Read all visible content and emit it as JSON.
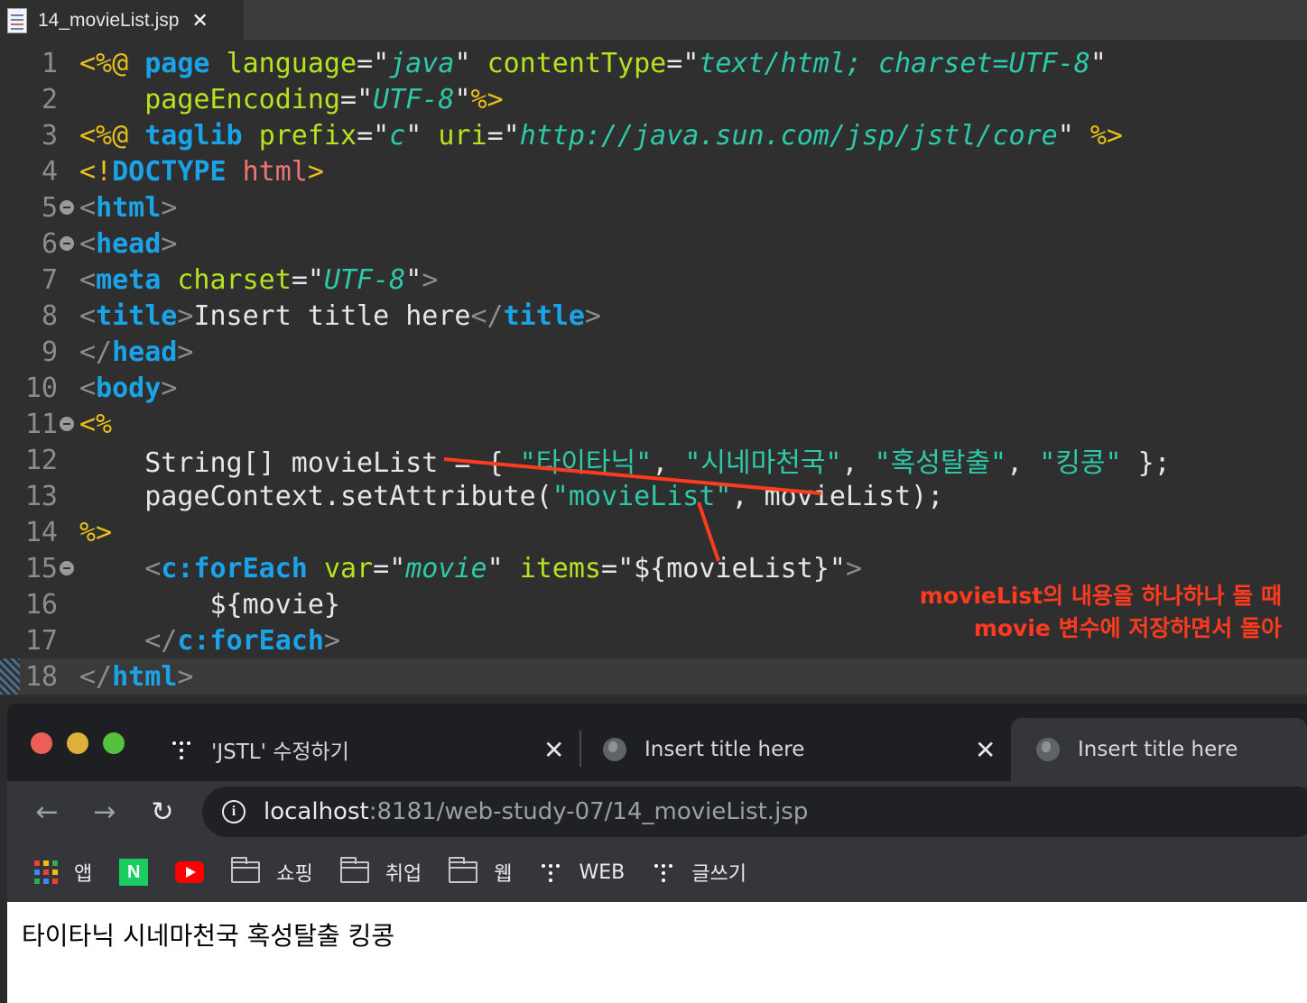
{
  "editor": {
    "tab_title": "14_movieList.jsp",
    "close_glyph": "✕",
    "lines": [
      {
        "num": "1",
        "fold": false,
        "current": false,
        "tokens": [
          {
            "t": "<%@ ",
            "c": "c-dir"
          },
          {
            "t": "page",
            "c": "c-kw"
          },
          {
            "t": " ",
            "c": "c-plain"
          },
          {
            "t": "language",
            "c": "c-attr"
          },
          {
            "t": "=",
            "c": "c-plain"
          },
          {
            "t": "\"",
            "c": "c-plain"
          },
          {
            "t": "java",
            "c": "c-str"
          },
          {
            "t": "\"",
            "c": "c-plain"
          },
          {
            "t": " ",
            "c": "c-plain"
          },
          {
            "t": "contentType",
            "c": "c-attr"
          },
          {
            "t": "=",
            "c": "c-plain"
          },
          {
            "t": "\"",
            "c": "c-plain"
          },
          {
            "t": "text/html; charset=UTF-8",
            "c": "c-str"
          },
          {
            "t": "\"",
            "c": "c-plain"
          }
        ]
      },
      {
        "num": "2",
        "fold": false,
        "current": false,
        "tokens": [
          {
            "t": "    ",
            "c": "c-plain"
          },
          {
            "t": "pageEncoding",
            "c": "c-attr"
          },
          {
            "t": "=",
            "c": "c-plain"
          },
          {
            "t": "\"",
            "c": "c-plain"
          },
          {
            "t": "UTF-8",
            "c": "c-str"
          },
          {
            "t": "\"",
            "c": "c-plain"
          },
          {
            "t": "%>",
            "c": "c-dir"
          }
        ]
      },
      {
        "num": "3",
        "fold": false,
        "current": false,
        "tokens": [
          {
            "t": "<%@ ",
            "c": "c-dir"
          },
          {
            "t": "taglib",
            "c": "c-kw"
          },
          {
            "t": " ",
            "c": "c-plain"
          },
          {
            "t": "prefix",
            "c": "c-attr"
          },
          {
            "t": "=",
            "c": "c-plain"
          },
          {
            "t": "\"",
            "c": "c-plain"
          },
          {
            "t": "c",
            "c": "c-str"
          },
          {
            "t": "\"",
            "c": "c-plain"
          },
          {
            "t": " ",
            "c": "c-plain"
          },
          {
            "t": "uri",
            "c": "c-attr"
          },
          {
            "t": "=",
            "c": "c-plain"
          },
          {
            "t": "\"",
            "c": "c-plain"
          },
          {
            "t": "http://java.sun.com/jsp/jstl/core",
            "c": "c-str"
          },
          {
            "t": "\"",
            "c": "c-plain"
          },
          {
            "t": " ",
            "c": "c-plain"
          },
          {
            "t": "%>",
            "c": "c-dir"
          }
        ]
      },
      {
        "num": "4",
        "fold": false,
        "current": false,
        "tokens": [
          {
            "t": "<!",
            "c": "c-dir"
          },
          {
            "t": "DOCTYPE",
            "c": "c-kw"
          },
          {
            "t": " ",
            "c": "c-plain"
          },
          {
            "t": "html",
            "c": "c-doc"
          },
          {
            "t": ">",
            "c": "c-dir"
          }
        ]
      },
      {
        "num": "5",
        "fold": true,
        "current": false,
        "tokens": [
          {
            "t": "<",
            "c": "c-br"
          },
          {
            "t": "html",
            "c": "c-kw"
          },
          {
            "t": ">",
            "c": "c-br"
          }
        ]
      },
      {
        "num": "6",
        "fold": true,
        "current": false,
        "tokens": [
          {
            "t": "<",
            "c": "c-br"
          },
          {
            "t": "head",
            "c": "c-kw"
          },
          {
            "t": ">",
            "c": "c-br"
          }
        ]
      },
      {
        "num": "7",
        "fold": false,
        "current": false,
        "tokens": [
          {
            "t": "<",
            "c": "c-br"
          },
          {
            "t": "meta",
            "c": "c-kw"
          },
          {
            "t": " ",
            "c": "c-plain"
          },
          {
            "t": "charset",
            "c": "c-attr"
          },
          {
            "t": "=",
            "c": "c-plain"
          },
          {
            "t": "\"",
            "c": "c-plain"
          },
          {
            "t": "UTF-8",
            "c": "c-str"
          },
          {
            "t": "\"",
            "c": "c-plain"
          },
          {
            "t": ">",
            "c": "c-br"
          }
        ]
      },
      {
        "num": "8",
        "fold": false,
        "current": false,
        "tokens": [
          {
            "t": "<",
            "c": "c-br"
          },
          {
            "t": "title",
            "c": "c-kw"
          },
          {
            "t": ">",
            "c": "c-br"
          },
          {
            "t": "Insert title here",
            "c": "c-plain"
          },
          {
            "t": "</",
            "c": "c-br"
          },
          {
            "t": "title",
            "c": "c-kw"
          },
          {
            "t": ">",
            "c": "c-br"
          }
        ]
      },
      {
        "num": "9",
        "fold": false,
        "current": false,
        "tokens": [
          {
            "t": "</",
            "c": "c-br"
          },
          {
            "t": "head",
            "c": "c-kw"
          },
          {
            "t": ">",
            "c": "c-br"
          }
        ]
      },
      {
        "num": "10",
        "fold": false,
        "current": false,
        "tokens": [
          {
            "t": "<",
            "c": "c-br"
          },
          {
            "t": "body",
            "c": "c-kw"
          },
          {
            "t": ">",
            "c": "c-br"
          }
        ]
      },
      {
        "num": "11",
        "fold": true,
        "current": false,
        "tokens": [
          {
            "t": "<%",
            "c": "c-dir"
          }
        ]
      },
      {
        "num": "12",
        "fold": false,
        "current": false,
        "tokens": [
          {
            "t": "    String[] movieList = { ",
            "c": "c-plain"
          },
          {
            "t": "\"타이타닉\"",
            "c": "c-jstr"
          },
          {
            "t": ", ",
            "c": "c-plain"
          },
          {
            "t": "\"시네마천국\"",
            "c": "c-jstr"
          },
          {
            "t": ", ",
            "c": "c-plain"
          },
          {
            "t": "\"혹성탈출\"",
            "c": "c-jstr"
          },
          {
            "t": ", ",
            "c": "c-plain"
          },
          {
            "t": "\"킹콩\"",
            "c": "c-jstr"
          },
          {
            "t": " };",
            "c": "c-plain"
          }
        ]
      },
      {
        "num": "13",
        "fold": false,
        "current": false,
        "tokens": [
          {
            "t": "    pageContext.setAttribute(",
            "c": "c-plain"
          },
          {
            "t": "\"movieList\"",
            "c": "c-jstr"
          },
          {
            "t": ", movieList);",
            "c": "c-plain"
          }
        ]
      },
      {
        "num": "14",
        "fold": false,
        "current": false,
        "tokens": [
          {
            "t": "%>",
            "c": "c-dir"
          }
        ]
      },
      {
        "num": "15",
        "fold": true,
        "current": false,
        "tokens": [
          {
            "t": "    ",
            "c": "c-plain"
          },
          {
            "t": "<",
            "c": "c-br"
          },
          {
            "t": "c:forEach",
            "c": "c-kw"
          },
          {
            "t": " ",
            "c": "c-plain"
          },
          {
            "t": "var",
            "c": "c-attr"
          },
          {
            "t": "=",
            "c": "c-plain"
          },
          {
            "t": "\"",
            "c": "c-plain"
          },
          {
            "t": "movie",
            "c": "c-str"
          },
          {
            "t": "\"",
            "c": "c-plain"
          },
          {
            "t": " ",
            "c": "c-plain"
          },
          {
            "t": "items",
            "c": "c-attr"
          },
          {
            "t": "=",
            "c": "c-plain"
          },
          {
            "t": "\"${movieList}\"",
            "c": "c-plain"
          },
          {
            "t": ">",
            "c": "c-br"
          }
        ]
      },
      {
        "num": "16",
        "fold": false,
        "current": false,
        "tokens": [
          {
            "t": "        ${movie}",
            "c": "c-plain"
          }
        ]
      },
      {
        "num": "17",
        "fold": false,
        "current": false,
        "tokens": [
          {
            "t": "    ",
            "c": "c-plain"
          },
          {
            "t": "</",
            "c": "c-br"
          },
          {
            "t": "c:forEach",
            "c": "c-kw"
          },
          {
            "t": ">",
            "c": "c-br"
          }
        ]
      },
      {
        "num": "18",
        "fold": false,
        "current": true,
        "tokens": [
          {
            "t": "</",
            "c": "c-br"
          },
          {
            "t": "html",
            "c": "c-kw"
          },
          {
            "t": ">",
            "c": "c-br"
          }
        ]
      }
    ]
  },
  "annotation": {
    "line1": "movieList의 내용을 하나하나 돌 때",
    "line2": "movie 변수에 저장하면서 돌아",
    "color": "#ff3b1f"
  },
  "browser": {
    "tabs": [
      {
        "title": "'JSTL' 수정하기",
        "active": false,
        "icon": "dots-icon"
      },
      {
        "title": "Insert title here",
        "active": false,
        "icon": "globe-icon"
      },
      {
        "title": "Insert title here",
        "active": true,
        "icon": "globe-icon"
      }
    ],
    "close_glyph": "✕",
    "nav": {
      "back": "←",
      "forward": "→",
      "reload": "↻"
    },
    "url_host": "localhost",
    "url_path": ":8181/web-study-07/14_movieList.jsp",
    "bookmarks": [
      {
        "label": "앱",
        "icon": "apps-icon"
      },
      {
        "label": "",
        "icon": "naver-icon",
        "glyph": "N"
      },
      {
        "label": "",
        "icon": "youtube-icon"
      },
      {
        "label": "쇼핑",
        "icon": "folder-icon"
      },
      {
        "label": "취업",
        "icon": "folder-icon"
      },
      {
        "label": "웹",
        "icon": "folder-icon"
      },
      {
        "label": "WEB",
        "icon": "dots-icon"
      },
      {
        "label": "글쓰기",
        "icon": "dots-icon"
      }
    ],
    "page_output": "타이타닉 시네마천국 혹성탈출 킹콩"
  }
}
